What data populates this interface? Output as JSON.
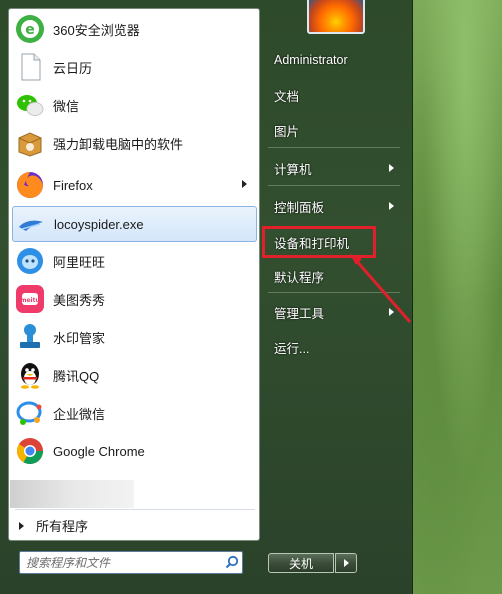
{
  "programs": [
    {
      "label": "360安全浏览器",
      "icon": "360-browser-icon"
    },
    {
      "label": "云日历",
      "icon": "blank-document-icon"
    },
    {
      "label": "微信",
      "icon": "wechat-icon"
    },
    {
      "label": "强力卸载电脑中的软件",
      "icon": "uninstall-box-icon"
    },
    {
      "label": "Firefox",
      "icon": "firefox-icon"
    },
    {
      "label": "locoyspider.exe",
      "icon": "locoyspider-icon"
    },
    {
      "label": "阿里旺旺",
      "icon": "aliwangwang-icon"
    },
    {
      "label": "美图秀秀",
      "icon": "meitu-icon"
    },
    {
      "label": "水印管家",
      "icon": "watermark-stamp-icon"
    },
    {
      "label": "腾讯QQ",
      "icon": "qq-penguin-icon"
    },
    {
      "label": "企业微信",
      "icon": "wecom-icon"
    },
    {
      "label": "Google Chrome",
      "icon": "chrome-icon"
    }
  ],
  "all_programs": "所有程序",
  "search": {
    "placeholder": "搜索程序和文件"
  },
  "right_items": [
    {
      "label": "Administrator"
    },
    {
      "label": "文档"
    },
    {
      "label": "图片"
    },
    {
      "label": "计算机"
    },
    {
      "label": "控制面板"
    },
    {
      "label": "设备和打印机"
    },
    {
      "label": "默认程序"
    },
    {
      "label": "管理工具"
    },
    {
      "label": "运行..."
    }
  ],
  "shutdown": {
    "label": "关机"
  },
  "colors": {
    "highlight_box": "#e0202a",
    "selection": "#d4e6fa"
  }
}
